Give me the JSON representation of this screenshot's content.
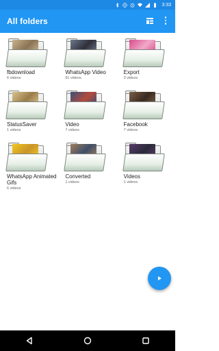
{
  "status_bar": {
    "time": "3:33",
    "icons": [
      "bluetooth-icon",
      "vibrate-icon",
      "alarm-icon",
      "wifi-icon",
      "signal-icon",
      "battery-icon"
    ]
  },
  "app_bar": {
    "title": "All folders",
    "actions": [
      "grid-view-icon",
      "more-vert-icon"
    ]
  },
  "folders": [
    {
      "name": "fbdownload",
      "count": "6 videos",
      "thumb_colors": [
        "#c9b48f",
        "#8a7355"
      ]
    },
    {
      "name": "WhatsApp Video",
      "count": "91 videos",
      "thumb_colors": [
        "#6d7a8c",
        "#2f2f3a"
      ]
    },
    {
      "name": "Export",
      "count": "3 videos",
      "thumb_colors": [
        "#d74b8b",
        "#f1a9c9"
      ]
    },
    {
      "name": "StatusSaver",
      "count": "1 videos",
      "thumb_colors": [
        "#d9c38a",
        "#9a7c4a"
      ]
    },
    {
      "name": "Video",
      "count": "7 videos",
      "thumb_colors": [
        "#3a4f7a",
        "#b44a3a"
      ]
    },
    {
      "name": "Facebook",
      "count": "7 videos",
      "thumb_colors": [
        "#7a6048",
        "#3a2a20"
      ]
    },
    {
      "name": "WhatsApp Animated Gifs",
      "count": "6 videos",
      "thumb_colors": [
        "#f2c61f",
        "#c9952a"
      ]
    },
    {
      "name": "Converted",
      "count": "1 videos",
      "thumb_colors": [
        "#a07d5a",
        "#3f4f6a"
      ]
    },
    {
      "name": "Videos",
      "count": "1 videos",
      "thumb_colors": [
        "#5a3a6a",
        "#2a2a3a"
      ]
    }
  ],
  "fab": {
    "icon": "play-icon"
  },
  "nav_bar": {
    "buttons": [
      "back-icon",
      "home-icon",
      "recents-icon"
    ]
  },
  "colors": {
    "primary": "#2196f3",
    "status": "#1e88e5"
  }
}
